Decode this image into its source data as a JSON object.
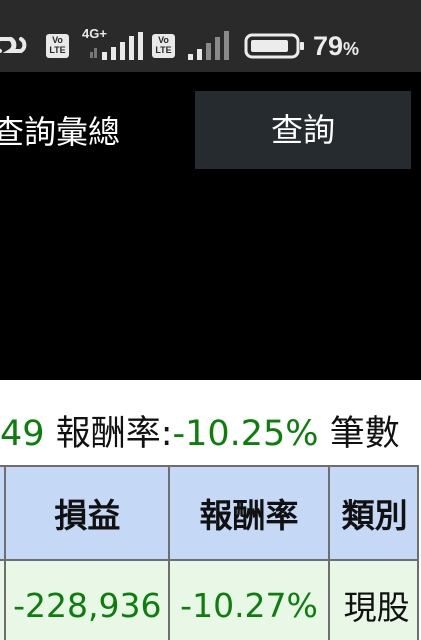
{
  "status_bar": {
    "network_type": "4G+",
    "volte_label_top": "Vo",
    "volte_label_bottom": "LTE",
    "battery_value": "79",
    "battery_unit": "%",
    "icons": [
      "link-icon",
      "volte-icon",
      "signal-icon",
      "volte-icon",
      "signal-icon",
      "battery-icon"
    ]
  },
  "query": {
    "title": "查詢彙總",
    "button_label": "查詢"
  },
  "summary": {
    "left_value": "49",
    "return_label": "報酬率:",
    "return_value": "-10.25%",
    "count_label": "筆數"
  },
  "table": {
    "headers": [
      "",
      "損益",
      "報酬率",
      "類別"
    ],
    "rows": [
      [
        "",
        "-228,936",
        "-10.27%",
        "現股"
      ]
    ]
  },
  "colors": {
    "header_bg": "#c5d9f7",
    "row_bg": "#e9f7e6",
    "negative_text": "#0a7f0a",
    "button_bg": "#262b2f"
  }
}
